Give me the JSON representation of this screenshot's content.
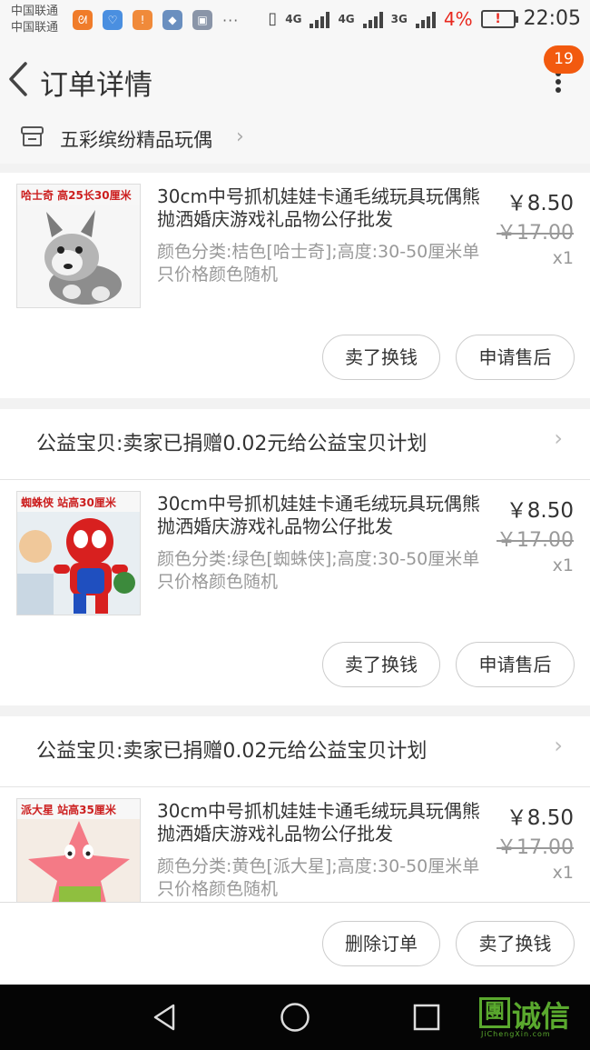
{
  "status_bar": {
    "carrier_1": "中国联通",
    "carrier_2": "中国联通",
    "network_1": "4G",
    "network_2": "4G",
    "network_3": "3G",
    "battery_percent": "4%",
    "time": "22:05",
    "apps": [
      {
        "icon": "weibo-icon",
        "color": "#f07c2a",
        "glyph": "ᘛ"
      },
      {
        "icon": "health-icon",
        "color": "#4a8fe0",
        "glyph": "♡"
      },
      {
        "icon": "alert-icon",
        "color": "#f08a3a",
        "glyph": "!"
      },
      {
        "icon": "diamond-icon",
        "color": "#6a8fbf",
        "glyph": "◆"
      },
      {
        "icon": "gallery-icon",
        "color": "#8a95a8",
        "glyph": "▣"
      }
    ],
    "more_dots": "···"
  },
  "header": {
    "title": "订单详情",
    "badge_count": "19"
  },
  "shop": {
    "name": "五彩缤纷精品玩偶"
  },
  "items": [
    {
      "caption": "哈士奇  高25长30厘米",
      "name": "30cm中号抓机娃娃卡通毛绒玩具玩偶熊抛洒婚庆游戏礼品物公仔批发",
      "spec": "颜色分类:桔色[哈士奇];高度:30-50厘米单只价格颜色随机",
      "price": "￥8.50",
      "original_price": "￥17.00",
      "quantity": "x1",
      "actions": [
        "卖了换钱",
        "申请售后"
      ]
    },
    {
      "caption": "蜘蛛侠  站高30厘米",
      "name": "30cm中号抓机娃娃卡通毛绒玩具玩偶熊抛洒婚庆游戏礼品物公仔批发",
      "spec": "颜色分类:绿色[蜘蛛侠];高度:30-50厘米单只价格颜色随机",
      "price": "￥8.50",
      "original_price": "￥17.00",
      "quantity": "x1",
      "actions": [
        "卖了换钱",
        "申请售后"
      ]
    },
    {
      "caption": "派大星  站高35厘米",
      "name": "30cm中号抓机娃娃卡通毛绒玩具玩偶熊抛洒婚庆游戏礼品物公仔批发",
      "spec": "颜色分类:黄色[派大星];高度:30-50厘米单只价格颜色随机",
      "price": "￥8.50",
      "original_price": "￥17.00",
      "quantity": "x1"
    }
  ],
  "charity_text": "公益宝贝:卖家已捐赠0.02元给公益宝贝计划",
  "bottom_actions": {
    "delete_order": "删除订单",
    "sell": "卖了换钱"
  },
  "watermark": {
    "box": "團",
    "text": "诚信",
    "sub": "JiChengXin.com"
  }
}
